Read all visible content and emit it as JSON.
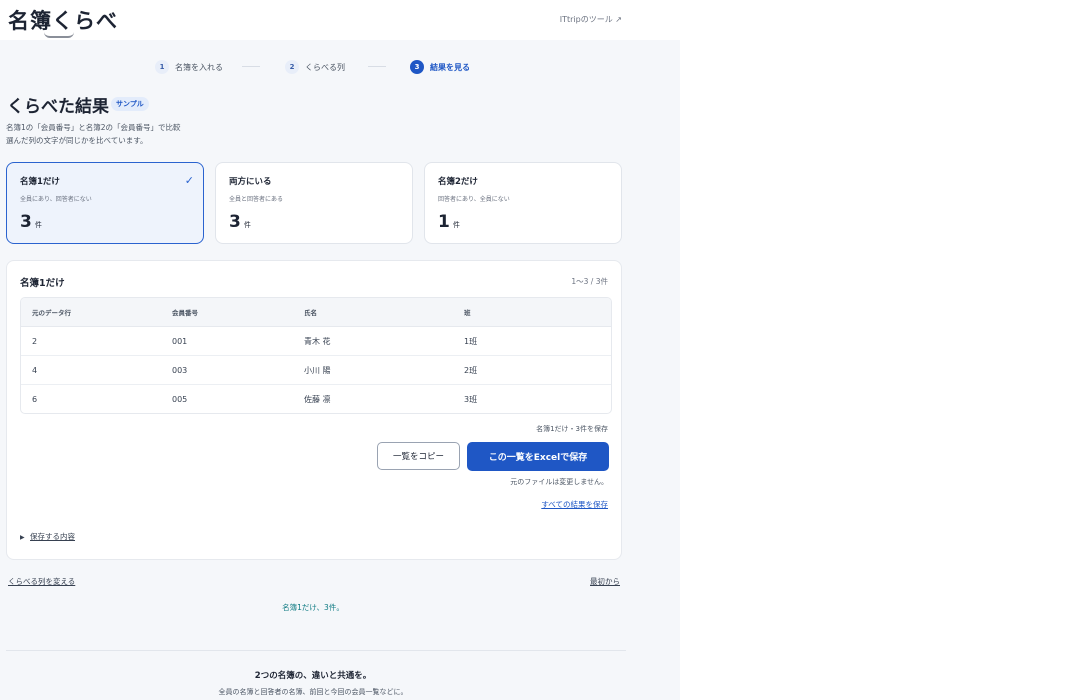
{
  "header": {
    "logo": "名簿くらべ",
    "tool_link": "ITtripのツール ↗"
  },
  "stepper": {
    "steps": [
      {
        "num": "1",
        "label": "名簿を入れる"
      },
      {
        "num": "2",
        "label": "くらべる列"
      },
      {
        "num": "3",
        "label": "結果を見る"
      }
    ]
  },
  "page": {
    "title": "くらべた結果",
    "badge": "サンプル",
    "desc_line1": "名簿1の「会員番号」と名簿2の「会員番号」で比較",
    "desc_line2": "選んだ列の文字が同じかを比べています。"
  },
  "cards": [
    {
      "title": "名簿1だけ",
      "sub": "全員にあり、回答者にない",
      "count": "3",
      "unit": "件"
    },
    {
      "title": "両方にいる",
      "sub": "全員と回答者にある",
      "count": "3",
      "unit": "件"
    },
    {
      "title": "名簿2だけ",
      "sub": "回答者にあり、全員にない",
      "count": "1",
      "unit": "件"
    }
  ],
  "check_icon": "✓",
  "result": {
    "title": "名簿1だけ",
    "range": "1〜3 / 3件",
    "columns": [
      "元のデータ行",
      "会員番号",
      "氏名",
      "班"
    ],
    "rows": [
      [
        "2",
        "001",
        "青木 花",
        "1班"
      ],
      [
        "4",
        "003",
        "小川 陽",
        "2班"
      ],
      [
        "6",
        "005",
        "佐藤 凛",
        "3班"
      ]
    ],
    "save_caption": "名簿1だけ・3件を保存",
    "copy_button": "一覧をコピー",
    "excel_button": "この一覧をExcelで保存",
    "note": "元のファイルは変更しません。",
    "all_link": "すべての結果を保存",
    "details_label": "保存する内容",
    "details_icon": "▶"
  },
  "bottom": {
    "change_columns": "くらべる列を変える",
    "restart": "最初から",
    "status": "名簿1だけ、3件。"
  },
  "footer": {
    "title": "2つの名簿の、違いと共通を。",
    "sub": "全員の名簿と回答者の名簿、前回と今回の会員一覧などに。"
  }
}
